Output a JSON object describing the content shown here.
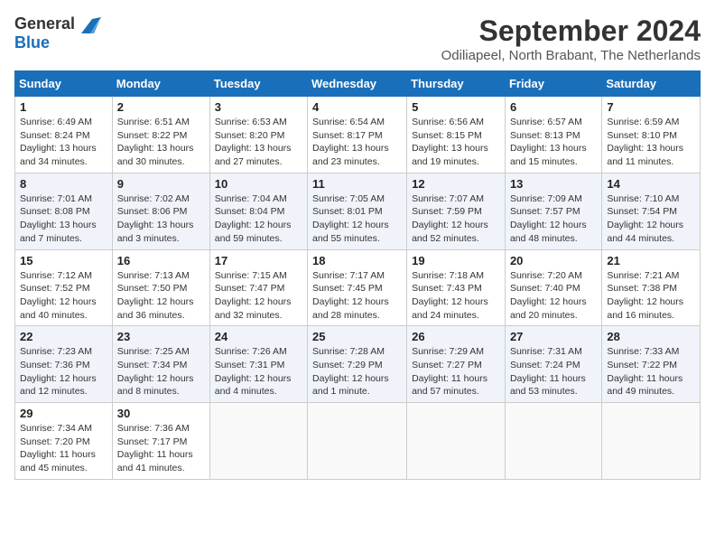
{
  "header": {
    "logo_general": "General",
    "logo_blue": "Blue",
    "month_title": "September 2024",
    "location": "Odiliapeel, North Brabant, The Netherlands"
  },
  "days_of_week": [
    "Sunday",
    "Monday",
    "Tuesday",
    "Wednesday",
    "Thursday",
    "Friday",
    "Saturday"
  ],
  "weeks": [
    [
      {
        "day": "1",
        "sunrise": "6:49 AM",
        "sunset": "8:24 PM",
        "daylight": "13 hours and 34 minutes."
      },
      {
        "day": "2",
        "sunrise": "6:51 AM",
        "sunset": "8:22 PM",
        "daylight": "13 hours and 30 minutes."
      },
      {
        "day": "3",
        "sunrise": "6:53 AM",
        "sunset": "8:20 PM",
        "daylight": "13 hours and 27 minutes."
      },
      {
        "day": "4",
        "sunrise": "6:54 AM",
        "sunset": "8:17 PM",
        "daylight": "13 hours and 23 minutes."
      },
      {
        "day": "5",
        "sunrise": "6:56 AM",
        "sunset": "8:15 PM",
        "daylight": "13 hours and 19 minutes."
      },
      {
        "day": "6",
        "sunrise": "6:57 AM",
        "sunset": "8:13 PM",
        "daylight": "13 hours and 15 minutes."
      },
      {
        "day": "7",
        "sunrise": "6:59 AM",
        "sunset": "8:10 PM",
        "daylight": "13 hours and 11 minutes."
      }
    ],
    [
      {
        "day": "8",
        "sunrise": "7:01 AM",
        "sunset": "8:08 PM",
        "daylight": "13 hours and 7 minutes."
      },
      {
        "day": "9",
        "sunrise": "7:02 AM",
        "sunset": "8:06 PM",
        "daylight": "13 hours and 3 minutes."
      },
      {
        "day": "10",
        "sunrise": "7:04 AM",
        "sunset": "8:04 PM",
        "daylight": "12 hours and 59 minutes."
      },
      {
        "day": "11",
        "sunrise": "7:05 AM",
        "sunset": "8:01 PM",
        "daylight": "12 hours and 55 minutes."
      },
      {
        "day": "12",
        "sunrise": "7:07 AM",
        "sunset": "7:59 PM",
        "daylight": "12 hours and 52 minutes."
      },
      {
        "day": "13",
        "sunrise": "7:09 AM",
        "sunset": "7:57 PM",
        "daylight": "12 hours and 48 minutes."
      },
      {
        "day": "14",
        "sunrise": "7:10 AM",
        "sunset": "7:54 PM",
        "daylight": "12 hours and 44 minutes."
      }
    ],
    [
      {
        "day": "15",
        "sunrise": "7:12 AM",
        "sunset": "7:52 PM",
        "daylight": "12 hours and 40 minutes."
      },
      {
        "day": "16",
        "sunrise": "7:13 AM",
        "sunset": "7:50 PM",
        "daylight": "12 hours and 36 minutes."
      },
      {
        "day": "17",
        "sunrise": "7:15 AM",
        "sunset": "7:47 PM",
        "daylight": "12 hours and 32 minutes."
      },
      {
        "day": "18",
        "sunrise": "7:17 AM",
        "sunset": "7:45 PM",
        "daylight": "12 hours and 28 minutes."
      },
      {
        "day": "19",
        "sunrise": "7:18 AM",
        "sunset": "7:43 PM",
        "daylight": "12 hours and 24 minutes."
      },
      {
        "day": "20",
        "sunrise": "7:20 AM",
        "sunset": "7:40 PM",
        "daylight": "12 hours and 20 minutes."
      },
      {
        "day": "21",
        "sunrise": "7:21 AM",
        "sunset": "7:38 PM",
        "daylight": "12 hours and 16 minutes."
      }
    ],
    [
      {
        "day": "22",
        "sunrise": "7:23 AM",
        "sunset": "7:36 PM",
        "daylight": "12 hours and 12 minutes."
      },
      {
        "day": "23",
        "sunrise": "7:25 AM",
        "sunset": "7:34 PM",
        "daylight": "12 hours and 8 minutes."
      },
      {
        "day": "24",
        "sunrise": "7:26 AM",
        "sunset": "7:31 PM",
        "daylight": "12 hours and 4 minutes."
      },
      {
        "day": "25",
        "sunrise": "7:28 AM",
        "sunset": "7:29 PM",
        "daylight": "12 hours and 1 minute."
      },
      {
        "day": "26",
        "sunrise": "7:29 AM",
        "sunset": "7:27 PM",
        "daylight": "11 hours and 57 minutes."
      },
      {
        "day": "27",
        "sunrise": "7:31 AM",
        "sunset": "7:24 PM",
        "daylight": "11 hours and 53 minutes."
      },
      {
        "day": "28",
        "sunrise": "7:33 AM",
        "sunset": "7:22 PM",
        "daylight": "11 hours and 49 minutes."
      }
    ],
    [
      {
        "day": "29",
        "sunrise": "7:34 AM",
        "sunset": "7:20 PM",
        "daylight": "11 hours and 45 minutes."
      },
      {
        "day": "30",
        "sunrise": "7:36 AM",
        "sunset": "7:17 PM",
        "daylight": "11 hours and 41 minutes."
      },
      null,
      null,
      null,
      null,
      null
    ]
  ]
}
